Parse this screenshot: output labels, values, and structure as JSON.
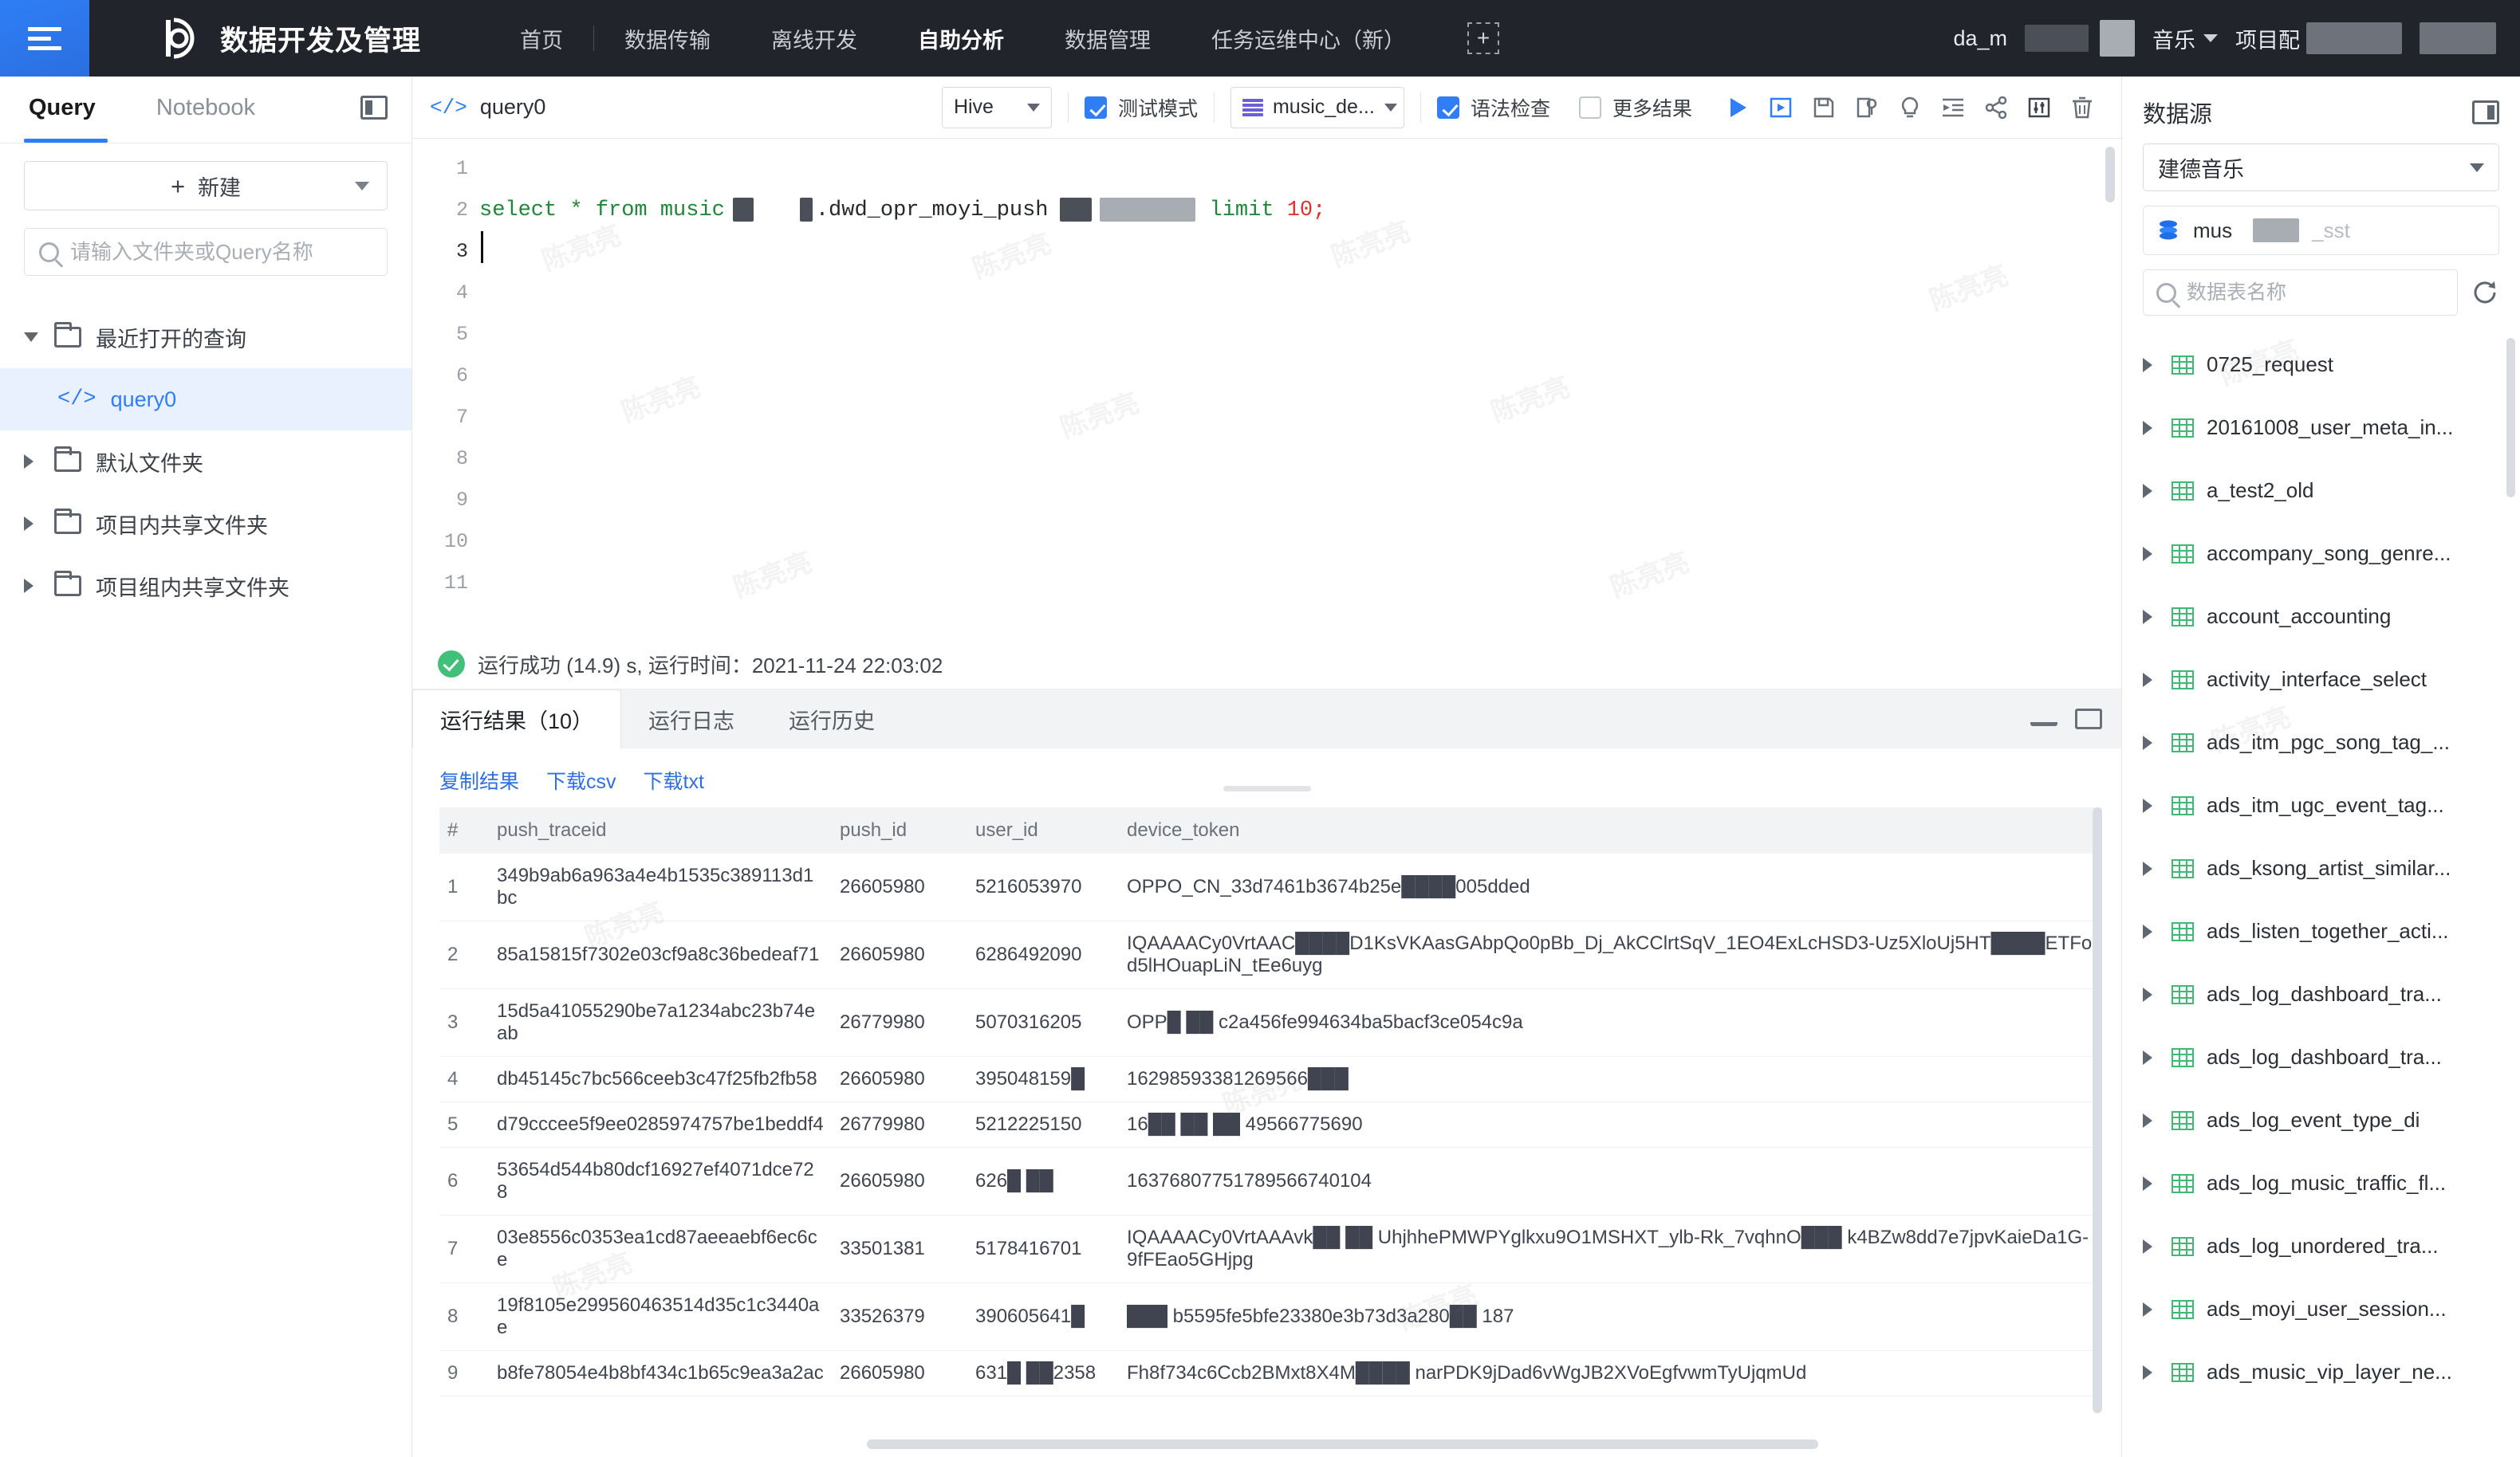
{
  "topbar": {
    "menu_icon": "hamburger-menu-icon",
    "brand": "数据开发及管理",
    "nav": [
      {
        "label": "首页",
        "active": false
      },
      {
        "label": "数据传输",
        "active": false
      },
      {
        "label": "离线开发",
        "active": false
      },
      {
        "label": "自助分析",
        "active": true
      },
      {
        "label": "数据管理",
        "active": false
      },
      {
        "label": "任务运维中心（新）",
        "active": false
      }
    ],
    "add_label": "+",
    "user": "da_m",
    "org": "音乐",
    "project_label": "项目配"
  },
  "left_panel": {
    "tabs": [
      {
        "label": "Query",
        "active": true
      },
      {
        "label": "Notebook",
        "active": false
      }
    ],
    "new_button": "新建",
    "search_placeholder": "请输入文件夹或Query名称",
    "tree": [
      {
        "label": "最近打开的查询",
        "type": "folder",
        "expanded": true,
        "selected": false,
        "indent": false
      },
      {
        "label": "query0",
        "type": "query",
        "expanded": false,
        "selected": true,
        "indent": true
      },
      {
        "label": "默认文件夹",
        "type": "folder",
        "expanded": false,
        "selected": false,
        "indent": false
      },
      {
        "label": "项目内共享文件夹",
        "type": "folder",
        "expanded": false,
        "selected": false,
        "indent": false
      },
      {
        "label": "项目组内共享文件夹",
        "type": "folder",
        "expanded": false,
        "selected": false,
        "indent": false
      }
    ]
  },
  "editor": {
    "tab_title": "query0",
    "engine": "Hive",
    "test_mode_label": "测试模式",
    "test_mode_checked": true,
    "database": "music_de...",
    "syntax_check_label": "语法检查",
    "syntax_check_checked": true,
    "more_results_label": "更多结果",
    "more_results_checked": false,
    "icons": [
      "run-icon",
      "run-step-icon",
      "save-icon",
      "save-as-icon",
      "lightbulb-icon",
      "format-icon",
      "share-icon",
      "settings-icon",
      "delete-icon"
    ],
    "line_numbers": [
      "1",
      "2",
      "3",
      "4",
      "5",
      "6",
      "7",
      "8",
      "9",
      "10",
      "11"
    ],
    "active_line": "3",
    "sql": {
      "prefix": "select * from music",
      "mid": ".dwd_opr_moyi_push",
      "suffix_keyword": "limit",
      "suffix_number": "10;"
    }
  },
  "run_status": {
    "text": "运行成功 (14.9) s,  运行时间：2021-11-24 22:03:02",
    "status": "success"
  },
  "results": {
    "tabs": [
      {
        "label": "运行结果（10）",
        "active": true
      },
      {
        "label": "运行日志",
        "active": false
      },
      {
        "label": "运行历史",
        "active": false
      }
    ],
    "links": [
      "复制结果",
      "下载csv",
      "下载txt"
    ],
    "columns": [
      "#",
      "push_traceid",
      "push_id",
      "user_id",
      "device_token"
    ],
    "rows": [
      {
        "idx": "1",
        "push_traceid": "349b9ab6a963a4e4b1535c389113d1bc",
        "push_id": "26605980",
        "user_id": "5216053970",
        "device_token": "OPPO_CN_33d7461b3674b25e████005dded"
      },
      {
        "idx": "2",
        "push_traceid": "85a15815f7302e03cf9a8c36bedeaf71",
        "push_id": "26605980",
        "user_id": "6286492090",
        "device_token": "IQAAAACy0VrtAAC████D1KsVKAasGAbpQo0pBb_Dj_AkCClrtSqV_1EO4ExLcHSD3-Uz5XloUj5HT████ETFod5lHOuapLiN_tEe6uyg"
      },
      {
        "idx": "3",
        "push_traceid": "15d5a41055290be7a1234abc23b74eab",
        "push_id": "26779980",
        "user_id": "5070316205",
        "device_token": "OPP█ ██ c2a456fe994634ba5bacf3ce054c9a"
      },
      {
        "idx": "4",
        "push_traceid": "db45145c7bc566ceeb3c47f25fb2fb58",
        "push_id": "26605980",
        "user_id": "395048159█",
        "device_token": "16298593381269566███"
      },
      {
        "idx": "5",
        "push_traceid": "d79cccee5f9ee0285974757be1beddf4",
        "push_id": "26779980",
        "user_id": "5212225150",
        "device_token": "16██ ██ ██ 49566775690"
      },
      {
        "idx": "6",
        "push_traceid": "53654d544b80dcf16927ef4071dce728",
        "push_id": "26605980",
        "user_id": "626█ ██",
        "device_token": "16376807751789566740104"
      },
      {
        "idx": "7",
        "push_traceid": "03e8556c0353ea1cd87aeeaebf6ec6ce",
        "push_id": "33501381",
        "user_id": "5178416701",
        "device_token": "IQAAAACy0VrtAAAvk██ ██ UhjhhePMWPYglkxu9O1MSHXT_ylb-Rk_7vqhnO███ k4BZw8dd7e7jpvKaieDa1G-9fFEao5GHjpg"
      },
      {
        "idx": "8",
        "push_traceid": "19f8105e299560463514d35c1c3440ae",
        "push_id": "33526379",
        "user_id": "390605641█",
        "device_token": "███ b5595fe5bfe23380e3b73d3a280██ 187"
      },
      {
        "idx": "9",
        "push_traceid": "b8fe78054e4b8bf434c1b65c9ea3a2ac",
        "push_id": "26605980",
        "user_id": "631█ ██2358",
        "device_token": "Fh8f734c6Ccb2BMxt8X4M████ narPDK9jDad6vWgJB2XVoEgfvwmTyUjqmUd"
      }
    ]
  },
  "right_panel": {
    "title": "数据源",
    "datasource": "建德音乐",
    "database": "mus",
    "database_suffix": "_sst",
    "search_placeholder": "数据表名称",
    "tables": [
      "0725_request",
      "20161008_user_meta_in...",
      "a_test2_old",
      "accompany_song_genre...",
      "account_accounting",
      "activity_interface_select",
      "ads_itm_pgc_song_tag_...",
      "ads_itm_ugc_event_tag...",
      "ads_ksong_artist_similar...",
      "ads_listen_together_acti...",
      "ads_log_dashboard_tra...",
      "ads_log_dashboard_tra...",
      "ads_log_event_type_di",
      "ads_log_music_traffic_fl...",
      "ads_log_unordered_tra...",
      "ads_moyi_user_session...",
      "ads_music_vip_layer_ne..."
    ]
  },
  "watermark": "陈亮亮",
  "colors": {
    "accent": "#2f7ef5",
    "topbar_bg": "#21242b",
    "success": "#41c07a",
    "link": "#2f6fe0"
  }
}
